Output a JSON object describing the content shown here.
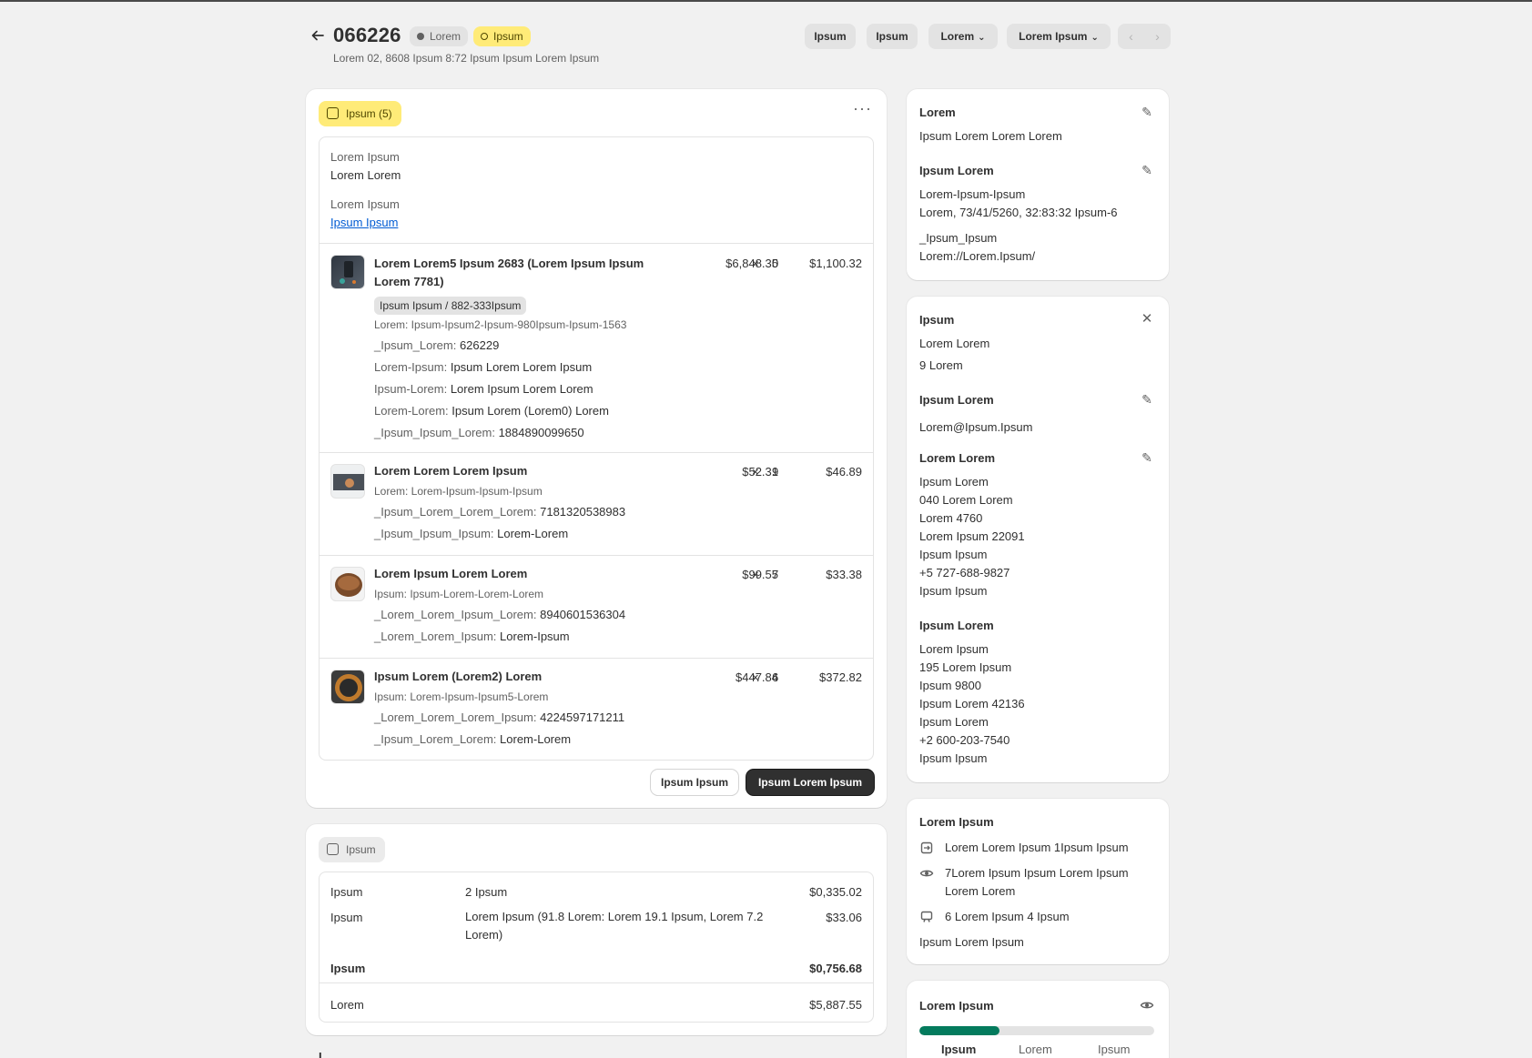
{
  "header": {
    "order_number": "066226",
    "badge_1": "Lorem",
    "badge_2": "Ipsum",
    "subtitle": "Lorem 02, 8608 Ipsum 8:72 Ipsum Ipsum Lorem Ipsum",
    "btn_1": "Ipsum",
    "btn_2": "Ipsum",
    "btn_3": "Lorem",
    "btn_4": "Lorem Ipsum"
  },
  "fulfillment": {
    "status_label": "Ipsum (5)",
    "field_1_label": "Lorem Ipsum",
    "field_1_value": "Lorem Lorem",
    "field_2_label": "Lorem Ipsum",
    "field_2_link": "Ipsum Ipsum",
    "items": [
      {
        "name": "Lorem Lorem5 Ipsum 2683 (Lorem Ipsum Ipsum Lorem 7781)",
        "variant": "Ipsum Ipsum / 882-333Ipsum",
        "sku": "Lorem: Ipsum-Ipsum2-Ipsum-980Ipsum-Ipsum-1563",
        "price": "$6,848.35",
        "qty": "0",
        "total": "$1,100.32",
        "props": [
          {
            "k": "_Ipsum_Lorem:",
            "v": "626229"
          },
          {
            "k": "Lorem-Ipsum:",
            "v": "Ipsum Lorem Lorem Ipsum"
          },
          {
            "k": "Ipsum-Lorem:",
            "v": "Lorem Ipsum Lorem Lorem"
          },
          {
            "k": "Lorem-Lorem:",
            "v": "Ipsum Lorem (Lorem0) Lorem"
          },
          {
            "k": "_Ipsum_Ipsum_Lorem:",
            "v": "1884890099650"
          }
        ]
      },
      {
        "name": "Lorem Lorem Lorem Ipsum",
        "sku": "Lorem: Lorem-Ipsum-Ipsum-Ipsum",
        "price": "$52.31",
        "qty": "9",
        "total": "$46.89",
        "props": [
          {
            "k": "_Ipsum_Lorem_Lorem_Lorem:",
            "v": "7181320538983"
          },
          {
            "k": "_Ipsum_Ipsum_Ipsum:",
            "v": "Lorem-Lorem"
          }
        ]
      },
      {
        "name": "Lorem Ipsum Lorem Lorem",
        "sku": "Ipsum: Ipsum-Lorem-Lorem-Lorem",
        "price": "$99.55",
        "qty": "7",
        "total": "$33.38",
        "props": [
          {
            "k": "_Lorem_Lorem_Ipsum_Lorem:",
            "v": "8940601536304"
          },
          {
            "k": "_Lorem_Lorem_Ipsum:",
            "v": "Lorem-Ipsum"
          }
        ]
      },
      {
        "name": "Ipsum Lorem (Lorem2) Lorem",
        "sku": "Ipsum: Lorem-Ipsum-Ipsum5-Lorem",
        "price": "$447.84",
        "qty": "6",
        "total": "$372.82",
        "props": [
          {
            "k": "_Lorem_Lorem_Lorem_Ipsum:",
            "v": "4224597171211"
          },
          {
            "k": "_Ipsum_Lorem_Lorem:",
            "v": "Lorem-Lorem"
          }
        ]
      }
    ],
    "times_symbol": "×",
    "secondary_btn": "Ipsum Ipsum",
    "primary_btn": "Ipsum Lorem Ipsum"
  },
  "payment": {
    "status_label": "Ipsum",
    "rows": [
      {
        "label": "Ipsum",
        "desc": "2 Ipsum",
        "amount": "$0,335.02"
      },
      {
        "label": "Ipsum",
        "desc": "Lorem Ipsum (91.8 Lorem: Lorem 19.1 Ipsum, Lorem 7.2 Lorem)",
        "amount": "$33.06"
      },
      {
        "label": "Ipsum",
        "desc": "",
        "amount": "$0,756.68"
      },
      {
        "label": "Lorem",
        "desc": "",
        "amount": "$5,887.55"
      }
    ]
  },
  "notes_card": {
    "title": "Lorem",
    "note": "Ipsum Lorem Lorem Lorem",
    "attr_title": "Ipsum Lorem",
    "attr_1": "Lorem-Ipsum-Ipsum",
    "attr_2": "Lorem, 73/41/5260, 32:83:32 Ipsum-6",
    "attr_3": "_Ipsum_Ipsum",
    "attr_4": "Lorem://Lorem.Ipsum/"
  },
  "customer_card": {
    "title": "Ipsum",
    "name_link": "Lorem Lorem",
    "orders_link": "9 Lorem",
    "contact_title": "Ipsum Lorem",
    "email": "Lorem@Ipsum.Ipsum",
    "ship_title": "Lorem Lorem",
    "ship_lines": [
      "Ipsum Lorem",
      "040 Lorem Lorem",
      "Lorem 4760",
      "Lorem Ipsum 22091",
      "Ipsum Ipsum"
    ],
    "ship_phone": "+5 727-688-9827",
    "ship_link": "Ipsum Ipsum",
    "bill_title": "Ipsum Lorem",
    "bill_lines": [
      "Lorem Ipsum",
      "195 Lorem Ipsum",
      "Ipsum 9800",
      "Ipsum Lorem 42136",
      "Ipsum Lorem"
    ],
    "bill_phone": "+2 600-203-7540",
    "bill_link": "Ipsum Ipsum"
  },
  "conversion_card": {
    "title": "Lorem Ipsum",
    "line_1": "Lorem Lorem Ipsum 1Ipsum Ipsum",
    "line_2": "7Lorem Ipsum Ipsum Lorem Ipsum Lorem Lorem",
    "line_3": "6 Lorem Ipsum 4 Ipsum",
    "link": "Ipsum Lorem Ipsum"
  },
  "risk_card": {
    "title": "Lorem Ipsum",
    "progress": 0.34,
    "progress_color": "#047b5d",
    "labels": [
      "Ipsum",
      "Lorem",
      "Ipsum"
    ]
  },
  "footer_partial": "L"
}
